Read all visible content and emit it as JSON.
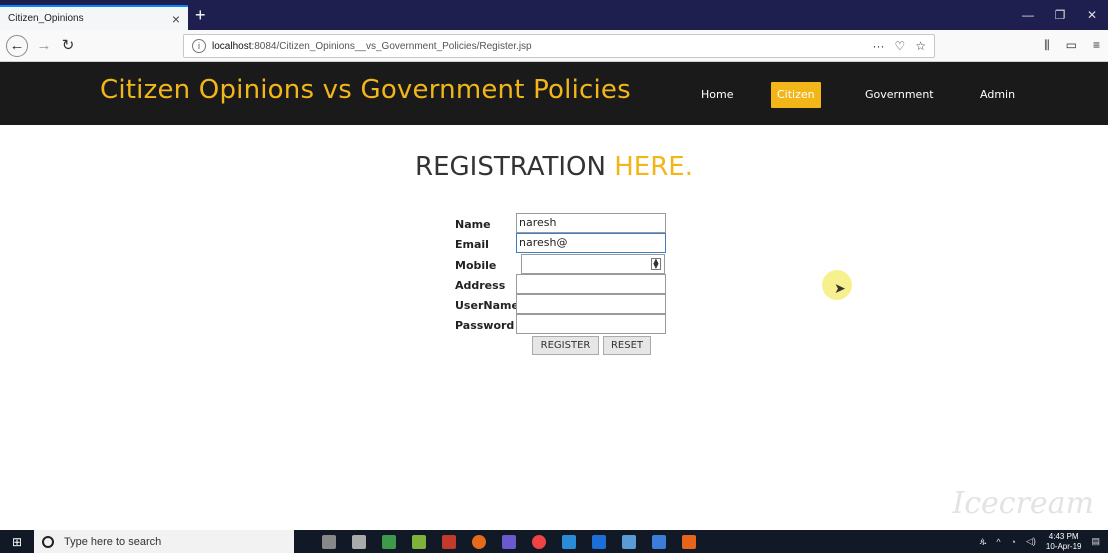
{
  "browser": {
    "tab_title": "Citizen_Opinions",
    "url_prefix": "localhost",
    "url_rest": ":8084/Citizen_Opinions__vs_Government_Policies/Register.jsp"
  },
  "site": {
    "title": "Citizen Opinions vs Government Policies",
    "menu": [
      "Home",
      "Citizen",
      "Government",
      "Admin"
    ],
    "active_menu": "Citizen",
    "accent_color": "#f2b619"
  },
  "registration": {
    "heading_main": "REGISTRATION",
    "heading_accent": "HERE.",
    "labels": {
      "name": "Name",
      "email": "Email",
      "mobile": "Mobile",
      "address": "Address",
      "username": "UserName",
      "password": "Password"
    },
    "values": {
      "name": "naresh",
      "email": "naresh@",
      "mobile": "",
      "address": "",
      "username": "",
      "password": ""
    },
    "register_label": "REGISTER",
    "reset_label": "RESET"
  },
  "taskbar": {
    "search_placeholder": "Type here to search",
    "time": "4:43 PM",
    "date": "10-Apr-19"
  },
  "watermark": "Icecream"
}
